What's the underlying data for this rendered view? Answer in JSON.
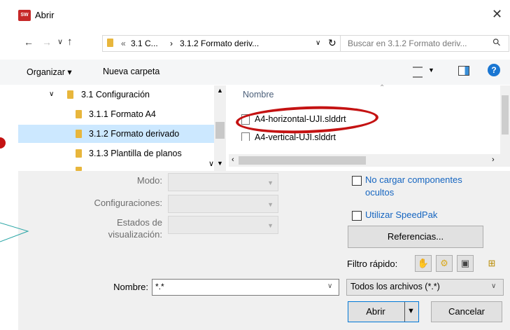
{
  "window": {
    "title": "Abrir",
    "app_icon_text": "SW 2016",
    "close_glyph": "✕"
  },
  "nav": {
    "back_glyph": "←",
    "forward_glyph": "→",
    "recent_glyph": "∨",
    "up_glyph": "↑",
    "breadcrumb": {
      "overflow": "«",
      "seg1": "3.1 C...",
      "separator": "›",
      "seg2": "3.1.2 Formato deriv..."
    },
    "dropdown_glyph": "∨",
    "refresh_glyph": "↻",
    "search_placeholder": "Buscar en 3.1.2 Formato deriv...",
    "search_glyph": "⚲"
  },
  "toolbar": {
    "organize_label": "Organizar ▾",
    "new_folder_label": "Nueva carpeta",
    "help_glyph": "?"
  },
  "tree": {
    "items": [
      {
        "label": "3.1 Configuración",
        "expander": "∨"
      },
      {
        "label": "3.1.1 Formato A4"
      },
      {
        "label": "3.1.2 Formato derivado",
        "selected": true
      },
      {
        "label": "3.1.3 Plantilla de planos"
      }
    ]
  },
  "filelist": {
    "column_header": "Nombre",
    "files": [
      {
        "name": "A4-horizontal-UJI.slddrt",
        "highlighted": true
      },
      {
        "name": "A4-vertical-UJI.slddrt"
      }
    ]
  },
  "options": {
    "mode_label": "Modo:",
    "configurations_label": "Configuraciones:",
    "display_states_label1": "Estados de",
    "display_states_label2": "visualización:",
    "no_load_hidden_label1": "No cargar componentes",
    "no_load_hidden_label2": "ocultos",
    "speedpak_label": "Utilizar SpeedPak",
    "references_button": "Referencias...",
    "quick_filter_label": "Filtro rápido:"
  },
  "footer": {
    "name_label": "Nombre:",
    "name_value": "*.*",
    "filetype_value": "Todos los archivos (*.*)",
    "open_button": "Abrir",
    "cancel_button": "Cancelar"
  },
  "colors": {
    "selection": "#cce8ff",
    "link": "#1565c0",
    "annotation": "#c41212",
    "folder": "#e8b63c"
  }
}
